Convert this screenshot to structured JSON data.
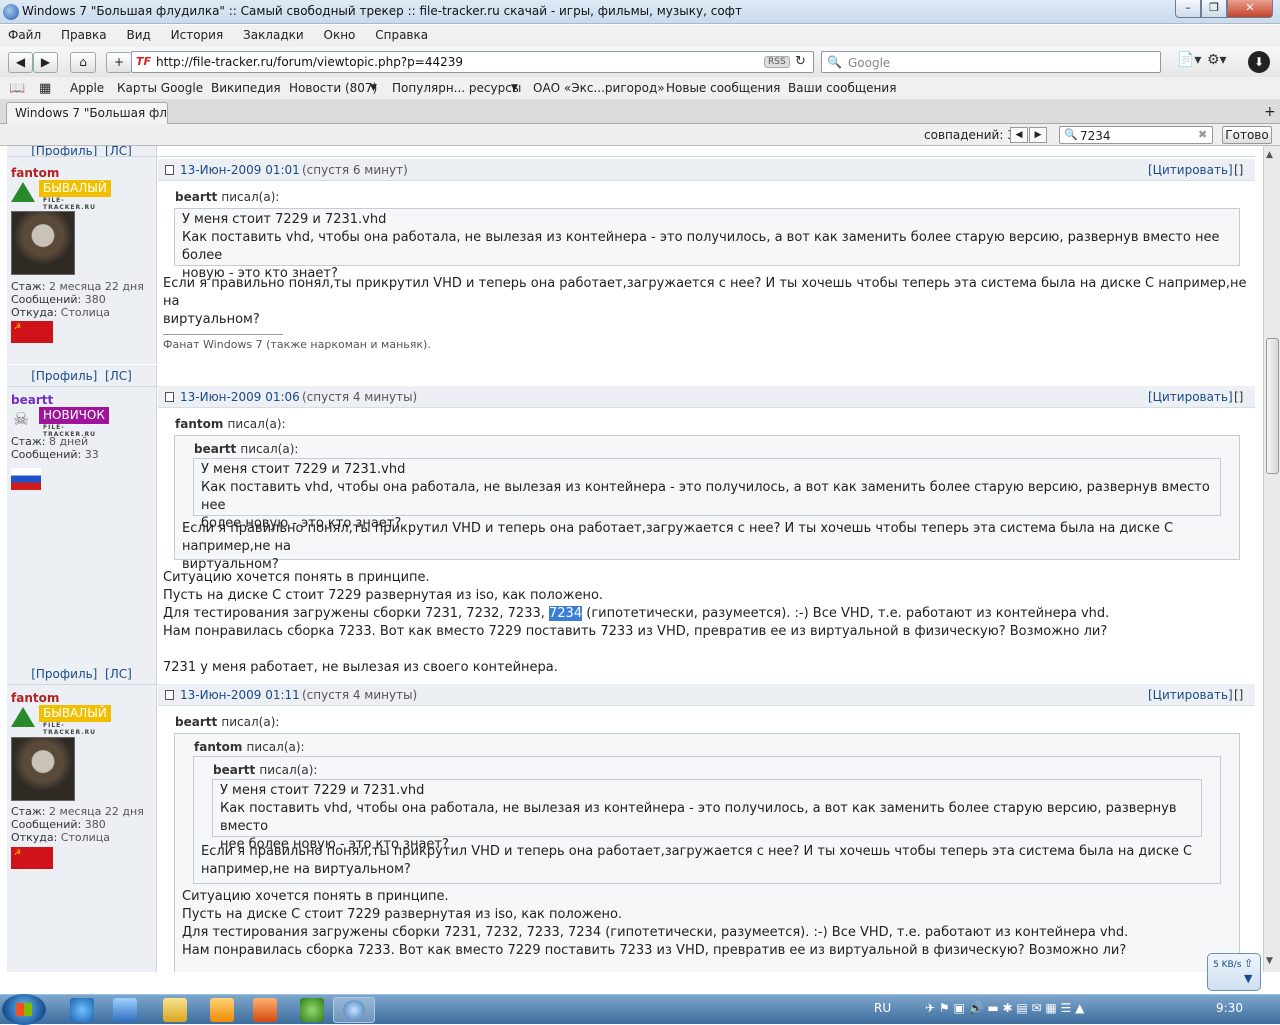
{
  "window": {
    "title": "Windows 7 \"Большая флудилка\" :: Самый свободный трекер :: file-tracker.ru скачай - игры, фильмы, музыку, софт"
  },
  "menu": [
    "Файл",
    "Правка",
    "Вид",
    "История",
    "Закладки",
    "Окно",
    "Справка"
  ],
  "nav": {
    "url": "http://file-tracker.ru/forum/viewtopic.php?p=44239",
    "rss": "RSS",
    "search_placeholder": "Google"
  },
  "bookmarks": [
    "Apple",
    "Карты Google",
    "Википедия",
    "Новости (807)",
    "Популярн... ресурсы",
    "ОАО «Экс...ригород»",
    "Новые сообщения",
    "Ваши сообщения"
  ],
  "tab": {
    "label": "Windows 7 \"Большая фл..."
  },
  "find": {
    "matches": "совпадений: 3",
    "query": "7234",
    "done": "Готово"
  },
  "common": {
    "profile": "[Профиль]",
    "pm": "[ЛС]",
    "quote": "[Цитировать]",
    "bracket": "[]",
    "wrote": "писал(а):"
  },
  "posts": [
    {
      "author": "fantom",
      "rank": "БЫВАЛЫЙ",
      "rank_sub": "FILE-TRACKER.RU",
      "stazh": "Стаж:",
      "stazh_v": "2 месяца 22 дня",
      "msgs": "Сообщений:",
      "msgs_v": "380",
      "from": "Откуда:",
      "from_v": "Столица",
      "date": "13-Июн-2009 01:01",
      "ago": "(спустя 6 минут)",
      "quote_author": "beartt",
      "quote_lines": [
        "У меня стоит 7229 и 7231.vhd",
        "Как поставить vhd, чтобы она работала, не вылезая из контейнера - это получилось, а вот как заменить более старую версию, развернув вместо нее более",
        "новую - это кто знает?"
      ],
      "text": [
        "Если я правильно понял,ты прикрутил VHD и теперь она работает,загружается с нее? И ты хочешь чтобы теперь эта система была на диске С например,не на",
        "виртуальном?"
      ],
      "signature": "Фанат Windows 7 (также наркоман и маньяк)."
    },
    {
      "author": "beartt",
      "rank": "НОВИЧОК",
      "rank_sub": "FILE-TRACKER.RU",
      "stazh": "Стаж:",
      "stazh_v": "8 дней",
      "msgs": "Сообщений:",
      "msgs_v": "33",
      "date": "13-Июн-2009 01:06",
      "ago": "(спустя 4 минуты)",
      "quote_author": "fantom",
      "inner_author": "beartt",
      "inner_lines": [
        "У меня стоит 7229 и 7231.vhd",
        "Как поставить vhd, чтобы она работала, не вылезая из контейнера - это получилось, а вот как заменить более старую версию, развернув вместо нее",
        "более новую - это кто знает?"
      ],
      "quote_lines": [
        "Если я правильно понял,ты прикрутил VHD и теперь она работает,загружается с нее? И ты хочешь чтобы теперь эта система была на диске С например,не на",
        "виртуальном?"
      ],
      "text1": "Ситуацию хочется понять в принципе.",
      "text2": "Пусть на диске С стоит 7229 развернутая из iso, как положено.",
      "text3a": "Для тестирования загружены сборки 7231, 7232, 7233, ",
      "text3hl": "7234",
      "text3b": " (гипотетически, разумеется). :-) Все VHD, т.е. работают из контейнера vhd.",
      "text4": "Нам понравилась сборка 7233. Вот как вместо 7229 поставить 7233 из VHD, превратив ее из виртуальной в физическую? Возможно ли?",
      "text5": "7231 у меня работает, не вылезая из своего контейнера."
    },
    {
      "author": "fantom",
      "rank": "БЫВАЛЫЙ",
      "rank_sub": "FILE-TRACKER.RU",
      "stazh": "Стаж:",
      "stazh_v": "2 месяца 22 дня",
      "msgs": "Сообщений:",
      "msgs_v": "380",
      "from": "Откуда:",
      "from_v": "Столица",
      "date": "13-Июн-2009 01:11",
      "ago": "(спустя 4 минуты)",
      "q1_author": "beartt",
      "q2_author": "fantom",
      "q3_author": "beartt",
      "q3_lines": [
        "У меня стоит 7229 и 7231.vhd",
        "Как поставить vhd, чтобы она работала, не вылезая из контейнера - это получилось, а вот как заменить более старую версию, развернув вместо",
        "нее более новую - это кто знает?"
      ],
      "q2_lines": [
        "Если я правильно понял,ты прикрутил VHD и теперь она работает,загружается с нее? И ты хочешь чтобы теперь эта система была на диске С",
        "например,не на виртуальном?"
      ],
      "q1_lines": [
        "Ситуацию хочется понять в принципе.",
        "Пусть на диске С стоит 7229 развернутая из iso, как положено.",
        "Для тестирования загружены сборки 7231, 7232, 7233, 7234 (гипотетически, разумеется). :-) Все VHD, т.е. работают из контейнера vhd.",
        "Нам понравилась сборка 7233. Вот как вместо 7229 поставить 7233 из VHD, превратив ее из виртуальной в физическую? Возможно ли?"
      ]
    }
  ],
  "taskbar": {
    "lang": "RU",
    "time": "9:30",
    "net": "5 KB/s"
  },
  "colors": {
    "fantom_name": "#b22222",
    "beartt_name": "#7030c0",
    "rank_veteran": "#f0c000",
    "rank_novice": "#a0149a",
    "highlight": "#3a7fd5"
  }
}
